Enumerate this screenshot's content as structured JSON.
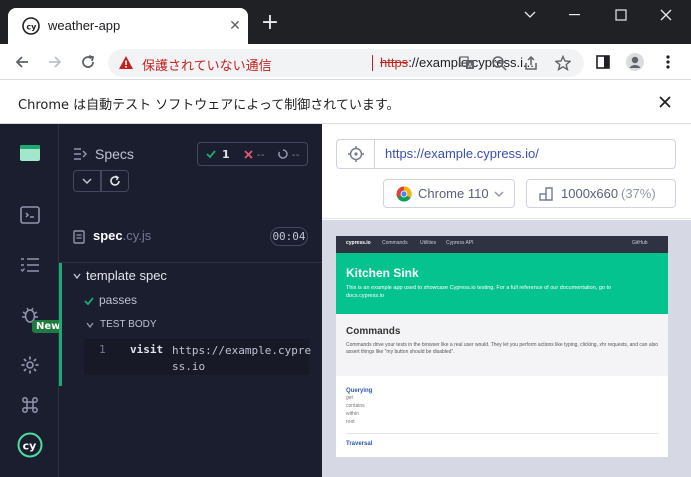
{
  "browser": {
    "tab_title": "weather-app",
    "tab_close": "✕",
    "new_tab": "+",
    "omnibox": {
      "warning_text": "保護されていない通信",
      "url_scheme": "https",
      "url_rest": "://example.cypress.i..."
    },
    "infobar_text": "Chrome は自動テスト ソフトウェアによって制御されています。"
  },
  "cypress": {
    "sidebar": {
      "new_badge": "New"
    },
    "specs_panel": {
      "title": "Specs",
      "passed_count": "1",
      "failed_count": "--",
      "pending_count": "--",
      "spec_name": "spec",
      "spec_ext": ".cy.js",
      "duration": "00:04",
      "suite_title": "template spec",
      "test_title": "passes",
      "test_body_label": "TEST BODY",
      "command": {
        "line": "1",
        "name": "visit",
        "arg": "https://example.cypress.io"
      }
    },
    "preview": {
      "url": "https://example.cypress.io/",
      "browser_label": "Chrome 110",
      "viewport_label": "1000x660",
      "viewport_scale": "(37%)"
    },
    "site": {
      "nav_brand": "cypress.io",
      "nav_commands": "Commands",
      "nav_utilities": "Utilities",
      "nav_api": "Cypress API",
      "nav_github": "GitHub",
      "hero_title": "Kitchen Sink",
      "hero_text": "This is an example app used to showcase Cypress.io testing. For a full reference of our documentation, go to docs.cypress.io",
      "commands_title": "Commands",
      "commands_text": "Commands drive your tests in the browser like a real user would. They let you perform actions like typing, clicking, xhr requests, and can also assert things like \"my button should be disabled\".",
      "querying_label": "Querying",
      "querying_items": [
        "get",
        "contains",
        "within",
        "root"
      ],
      "traversal_label": "Traversal"
    }
  },
  "colors": {
    "accent_green": "#1fa971",
    "warning_red": "#c5221f",
    "hero_green": "#04c38e",
    "panel_bg": "#1b1e2e"
  }
}
